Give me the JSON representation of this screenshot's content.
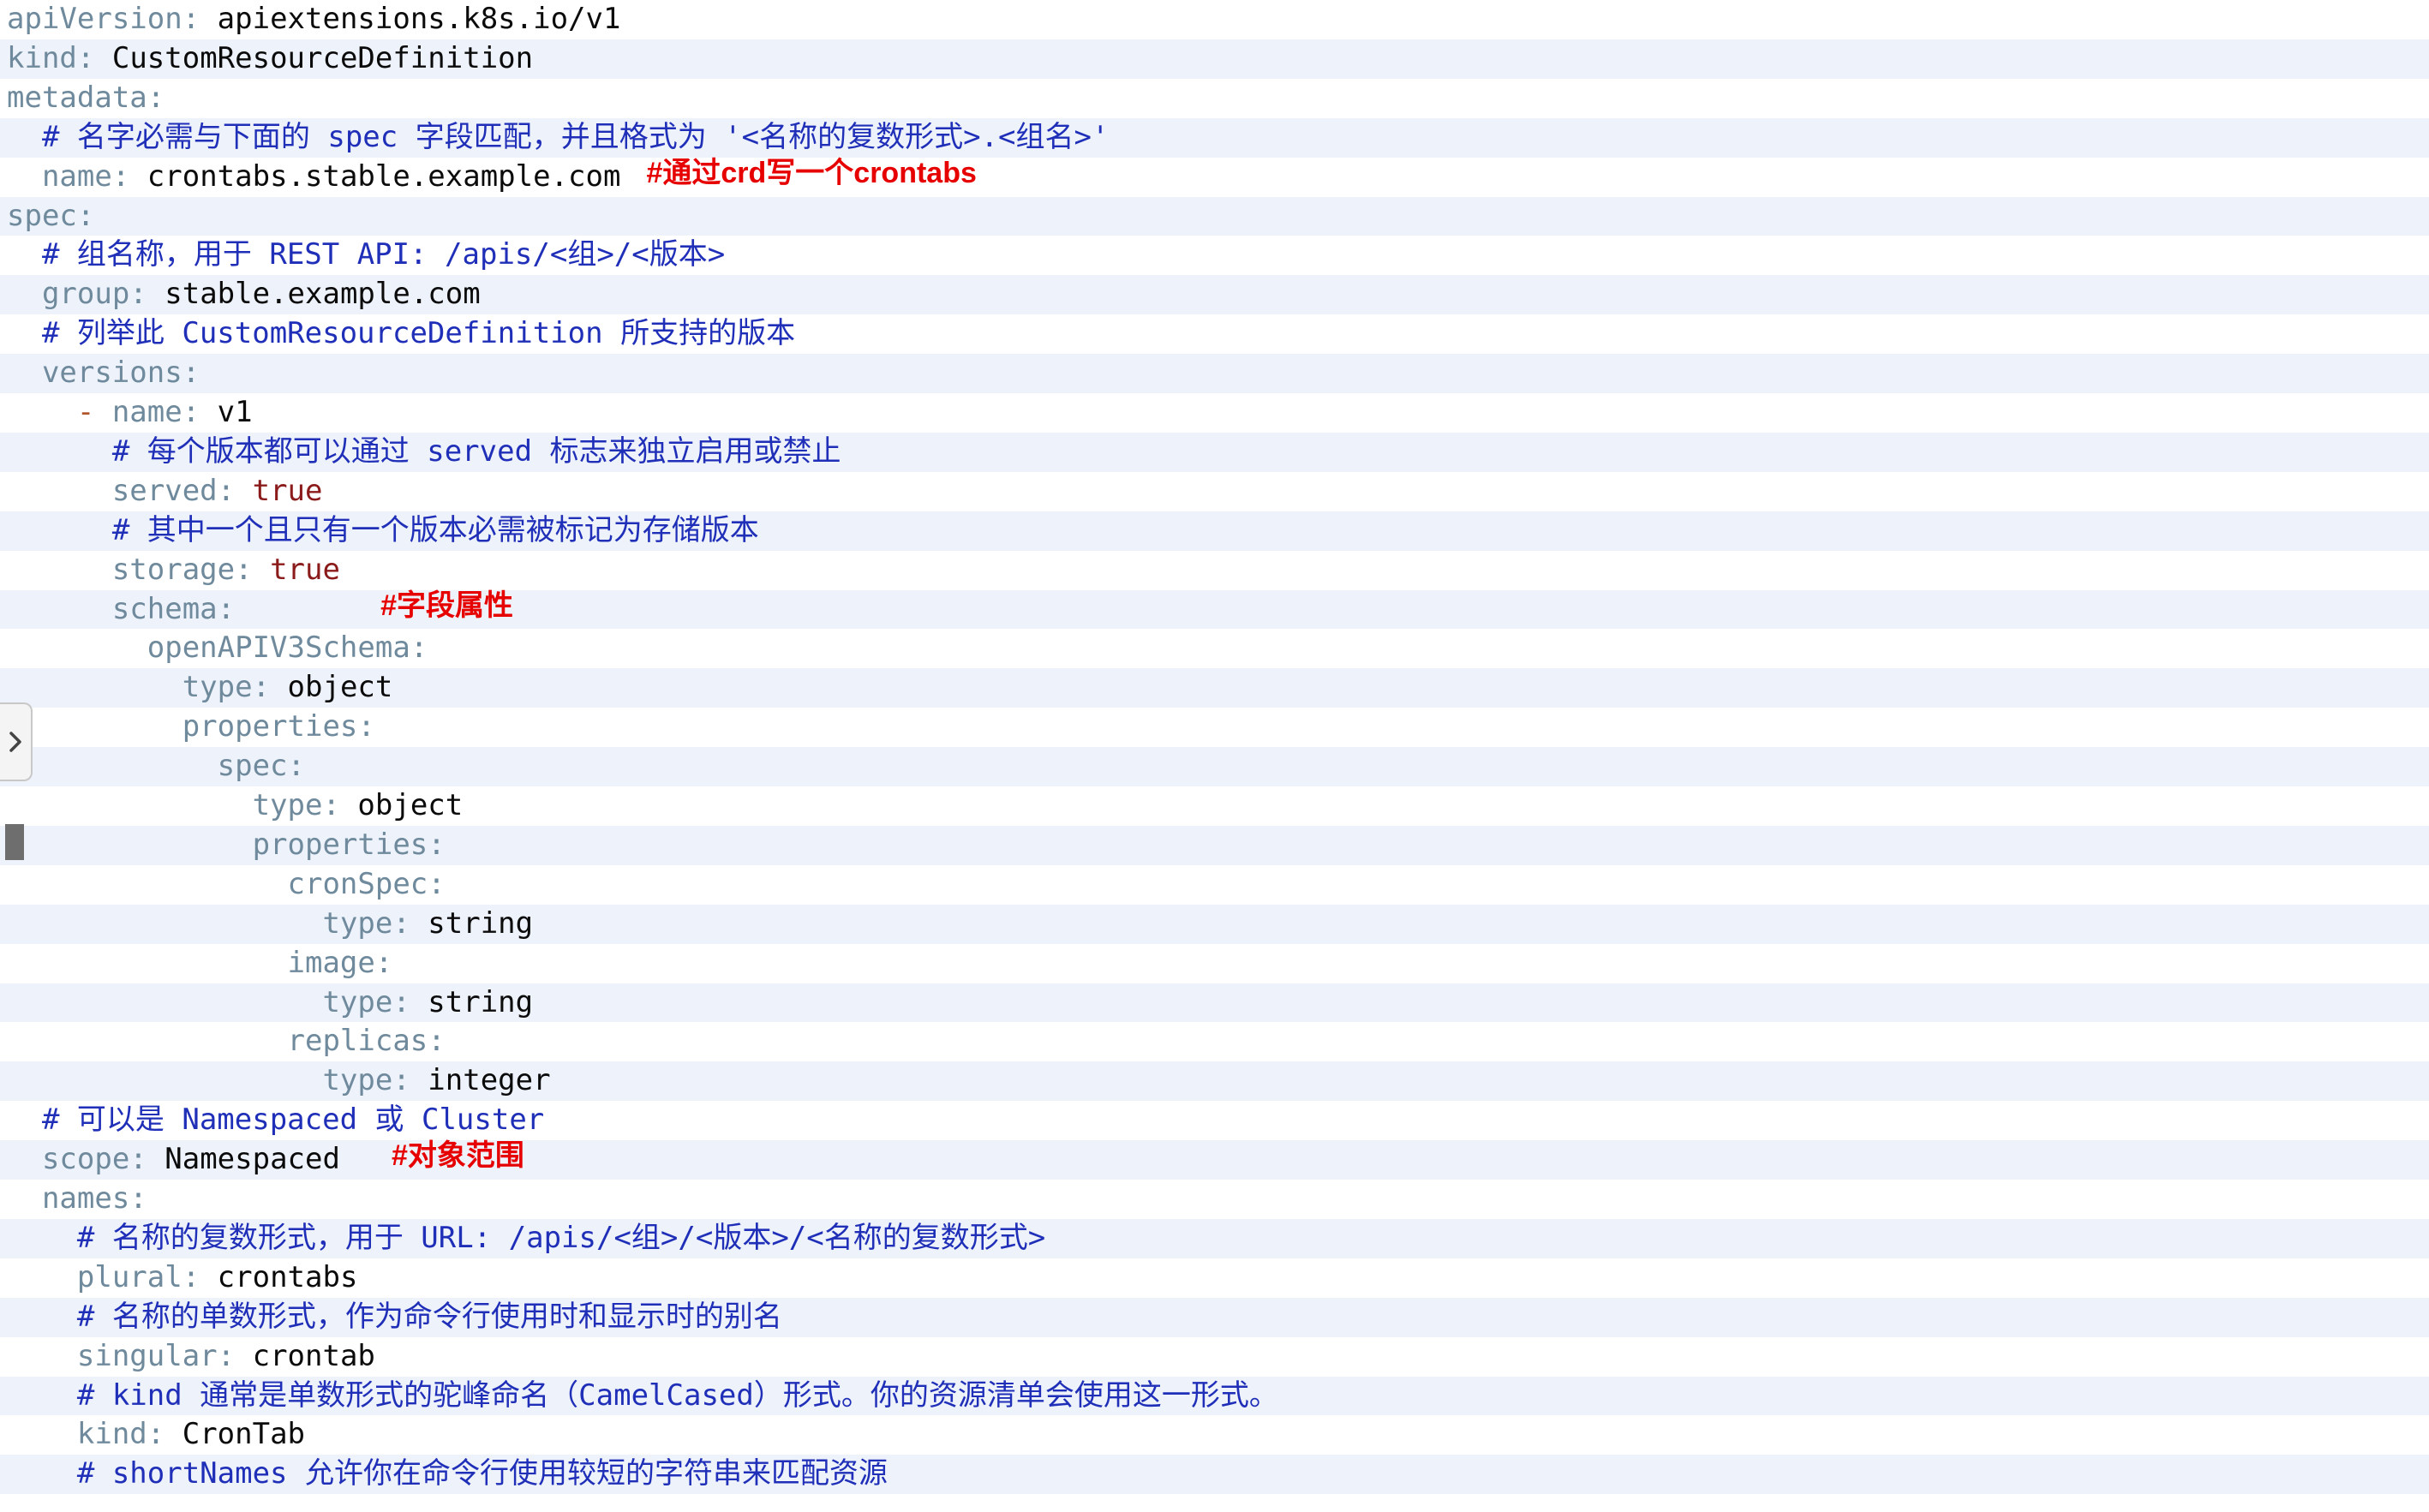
{
  "editor": {
    "lines": [
      [
        {
          "t": "apiVersion",
          "c": "k"
        },
        {
          "t": ": ",
          "c": "p"
        },
        {
          "t": "apiextensions.k8s.io/v1",
          "c": "v"
        }
      ],
      [
        {
          "t": "kind",
          "c": "k"
        },
        {
          "t": ": ",
          "c": "p"
        },
        {
          "t": "CustomResourceDefinition",
          "c": "v"
        }
      ],
      [
        {
          "t": "metadata",
          "c": "k"
        },
        {
          "t": ":",
          "c": "p"
        }
      ],
      [
        {
          "t": "  # 名字必需与下面的 spec 字段匹配，并且格式为 '<名称的复数形式>.<组名>'",
          "c": "c"
        }
      ],
      [
        {
          "t": "  name",
          "c": "k"
        },
        {
          "t": ": ",
          "c": "p"
        },
        {
          "t": "crontabs.stable.example.com",
          "c": "v"
        }
      ],
      [
        {
          "t": "spec",
          "c": "k"
        },
        {
          "t": ":",
          "c": "p"
        }
      ],
      [
        {
          "t": "  # 组名称，用于 REST API: /apis/<组>/<版本>",
          "c": "c"
        }
      ],
      [
        {
          "t": "  group",
          "c": "k"
        },
        {
          "t": ": ",
          "c": "p"
        },
        {
          "t": "stable.example.com",
          "c": "v"
        }
      ],
      [
        {
          "t": "  # 列举此 CustomResourceDefinition 所支持的版本",
          "c": "c"
        }
      ],
      [
        {
          "t": "  versions",
          "c": "k"
        },
        {
          "t": ":",
          "c": "p"
        }
      ],
      [
        {
          "t": "    - ",
          "c": "d"
        },
        {
          "t": "name",
          "c": "k"
        },
        {
          "t": ": ",
          "c": "p"
        },
        {
          "t": "v1",
          "c": "v"
        }
      ],
      [
        {
          "t": "      # 每个版本都可以通过 served 标志来独立启用或禁止",
          "c": "c"
        }
      ],
      [
        {
          "t": "      served",
          "c": "k"
        },
        {
          "t": ": ",
          "c": "p"
        },
        {
          "t": "true",
          "c": "b"
        }
      ],
      [
        {
          "t": "      # 其中一个且只有一个版本必需被标记为存储版本",
          "c": "c"
        }
      ],
      [
        {
          "t": "      storage",
          "c": "k"
        },
        {
          "t": ": ",
          "c": "p"
        },
        {
          "t": "true",
          "c": "b"
        }
      ],
      [
        {
          "t": "      schema",
          "c": "k"
        },
        {
          "t": ":",
          "c": "p"
        }
      ],
      [
        {
          "t": "        openAPIV3Schema",
          "c": "k"
        },
        {
          "t": ":",
          "c": "p"
        }
      ],
      [
        {
          "t": "          type",
          "c": "k"
        },
        {
          "t": ": ",
          "c": "p"
        },
        {
          "t": "object",
          "c": "v"
        }
      ],
      [
        {
          "t": "          properties",
          "c": "k"
        },
        {
          "t": ":",
          "c": "p"
        }
      ],
      [
        {
          "t": "            spec",
          "c": "k"
        },
        {
          "t": ":",
          "c": "p"
        }
      ],
      [
        {
          "t": "              type",
          "c": "k"
        },
        {
          "t": ": ",
          "c": "p"
        },
        {
          "t": "object",
          "c": "v"
        }
      ],
      [
        {
          "t": "              properties",
          "c": "k"
        },
        {
          "t": ":",
          "c": "p"
        }
      ],
      [
        {
          "t": "                cronSpec",
          "c": "k"
        },
        {
          "t": ":",
          "c": "p"
        }
      ],
      [
        {
          "t": "                  type",
          "c": "k"
        },
        {
          "t": ": ",
          "c": "p"
        },
        {
          "t": "string",
          "c": "v"
        }
      ],
      [
        {
          "t": "                image",
          "c": "k"
        },
        {
          "t": ":",
          "c": "p"
        }
      ],
      [
        {
          "t": "                  type",
          "c": "k"
        },
        {
          "t": ": ",
          "c": "p"
        },
        {
          "t": "string",
          "c": "v"
        }
      ],
      [
        {
          "t": "                replicas",
          "c": "k"
        },
        {
          "t": ":",
          "c": "p"
        }
      ],
      [
        {
          "t": "                  type",
          "c": "k"
        },
        {
          "t": ": ",
          "c": "p"
        },
        {
          "t": "integer",
          "c": "v"
        }
      ],
      [
        {
          "t": "  # 可以是 Namespaced 或 Cluster",
          "c": "c"
        }
      ],
      [
        {
          "t": "  scope",
          "c": "k"
        },
        {
          "t": ": ",
          "c": "p"
        },
        {
          "t": "Namespaced",
          "c": "v"
        }
      ],
      [
        {
          "t": "  names",
          "c": "k"
        },
        {
          "t": ":",
          "c": "p"
        }
      ],
      [
        {
          "t": "    # 名称的复数形式，用于 URL: /apis/<组>/<版本>/<名称的复数形式>",
          "c": "c"
        }
      ],
      [
        {
          "t": "    plural",
          "c": "k"
        },
        {
          "t": ": ",
          "c": "p"
        },
        {
          "t": "crontabs",
          "c": "v"
        }
      ],
      [
        {
          "t": "    # 名称的单数形式，作为命令行使用时和显示时的别名",
          "c": "c"
        }
      ],
      [
        {
          "t": "    singular",
          "c": "k"
        },
        {
          "t": ": ",
          "c": "p"
        },
        {
          "t": "crontab",
          "c": "v"
        }
      ],
      [
        {
          "t": "    # kind 通常是单数形式的驼峰命名（CamelCased）形式。你的资源清单会使用这一形式。",
          "c": "c"
        }
      ],
      [
        {
          "t": "    kind",
          "c": "k"
        },
        {
          "t": ": ",
          "c": "p"
        },
        {
          "t": "CronTab",
          "c": "v"
        }
      ],
      [
        {
          "t": "    # shortNames 允许你在命令行使用较短的字符串来匹配资源",
          "c": "c"
        }
      ]
    ],
    "annotations": [
      {
        "line": 4,
        "text": "#通过crd写一个crontabs"
      },
      {
        "line": 15,
        "text": "#字段属性"
      },
      {
        "line": 29,
        "text": "#对象范围"
      }
    ]
  },
  "colors": {
    "key": "#6f8a9c",
    "comment": "#1f2fb8",
    "boolean": "#8b1a1a",
    "value": "#0b0b0b",
    "annotation": "#e60000",
    "stripe": "#eef2fb"
  },
  "gutter": {
    "toggle_icon": "chevron-right-icon"
  }
}
